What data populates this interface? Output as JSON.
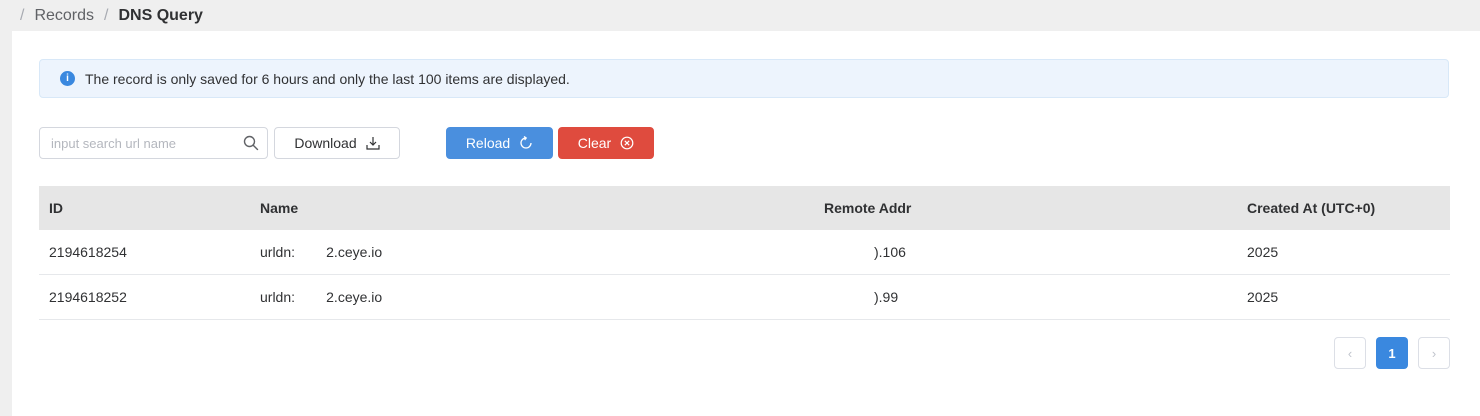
{
  "breadcrumb": {
    "sep": "/",
    "items": [
      "Records",
      "DNS Query"
    ]
  },
  "alert": {
    "icon": "info-icon",
    "icon_text": "i",
    "text": "The record is only saved for 6 hours and only the last 100 items are displayed."
  },
  "toolbar": {
    "search_placeholder": "input search url name",
    "download_label": "Download",
    "reload_label": "Reload",
    "clear_label": "Clear"
  },
  "table": {
    "columns": [
      "ID",
      "Name",
      "Remote Addr",
      "Created At (UTC+0)"
    ],
    "rows": [
      [
        "2194618254",
        "urldn:        2.ceye.io",
        ").106",
        "2025"
      ],
      [
        "2194618252",
        "urldn:        2.ceye.io",
        ").99",
        "2025"
      ]
    ]
  },
  "pagination": {
    "prev": "‹",
    "current": "1",
    "next": "›"
  },
  "colors": {
    "primary": "#4a8fde",
    "danger": "#df4b3e",
    "info": "#3a88df"
  }
}
